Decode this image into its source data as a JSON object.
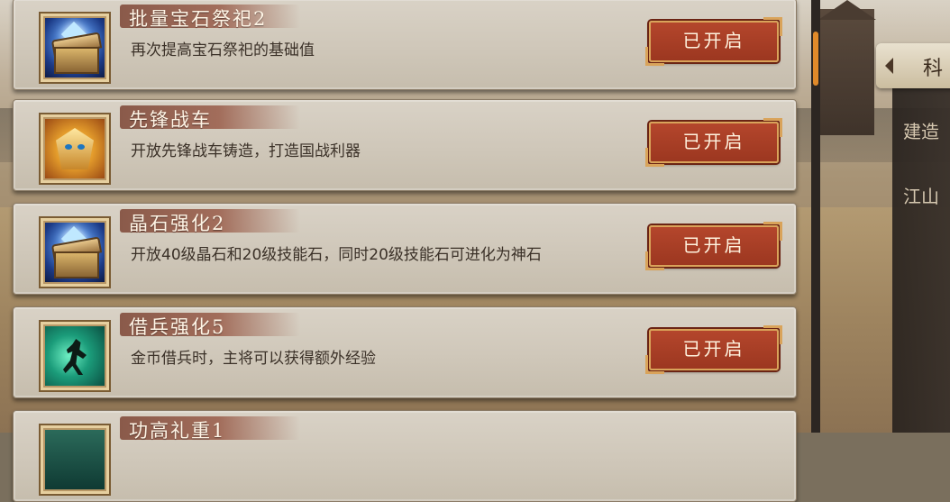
{
  "side_menu": {
    "active_tab": "科",
    "items": [
      "建造",
      "江山"
    ]
  },
  "cards": [
    {
      "title": "批量宝石祭祀2",
      "desc": "再次提高宝石祭祀的基础值",
      "status": "已开启",
      "icon": "treasure-chest-icon"
    },
    {
      "title": "先锋战车",
      "desc": "开放先锋战车铸造，打造国战利器",
      "status": "已开启",
      "icon": "dragon-emblem-icon"
    },
    {
      "title": "晶石强化2",
      "desc": "开放40级晶石和20级技能石，同时20级技能石可进化为神石",
      "status": "已开启",
      "icon": "treasure-chest-icon"
    },
    {
      "title": "借兵强化5",
      "desc": "金币借兵时，主将可以获得额外经验",
      "status": "已开启",
      "icon": "runner-icon"
    },
    {
      "title": "功高礼重1",
      "desc": "",
      "status": "",
      "icon": "reward-icon"
    }
  ],
  "colors": {
    "status_button": "#a63c24",
    "title_ribbon": "#9a6554",
    "scroll_accent": "#e08a2a"
  }
}
